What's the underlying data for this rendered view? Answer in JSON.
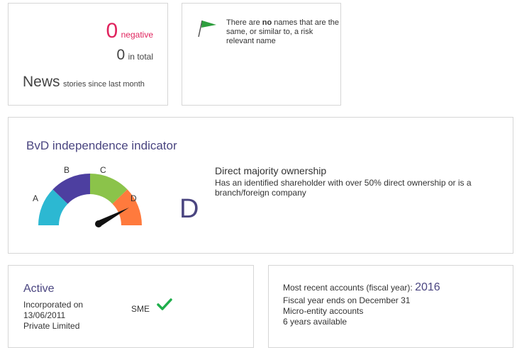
{
  "news": {
    "negative_count": "0",
    "negative_label": "negative",
    "total_count": "0",
    "total_label": "in total",
    "title": "News",
    "subtitle": "stories since last month"
  },
  "names": {
    "icon": "flag-icon",
    "flag_color": "#2e9e3e",
    "text_before": "There are ",
    "text_bold": "no",
    "text_after": " names that are the same, or similar to, a risk relevant name"
  },
  "bvd": {
    "title": "BvD independence indicator",
    "gauge_labels": [
      "A",
      "B",
      "C",
      "D"
    ],
    "gauge_colors": [
      "#2cb8d2",
      "#4d3fa0",
      "#8bc34a",
      "#ff7a3d"
    ],
    "grade": "D",
    "ownership_title": "Direct majority ownership",
    "ownership_description": "Has an identified shareholder with over 50% direct ownership or is a branch/foreign company"
  },
  "active": {
    "status": "Active",
    "incorporated_label": "Incorporated on",
    "incorporated_date": "13/06/2011",
    "company_type": "Private Limited",
    "sme_label": "SME",
    "sme_icon": "check-icon",
    "check_color": "#1fae4b"
  },
  "accounts": {
    "recent_label": "Most recent accounts (fiscal year):",
    "recent_year": "2016",
    "fiscal_year_end": "Fiscal year ends on December 31",
    "account_type": "Micro-entity accounts",
    "years_available": "6 years available"
  }
}
